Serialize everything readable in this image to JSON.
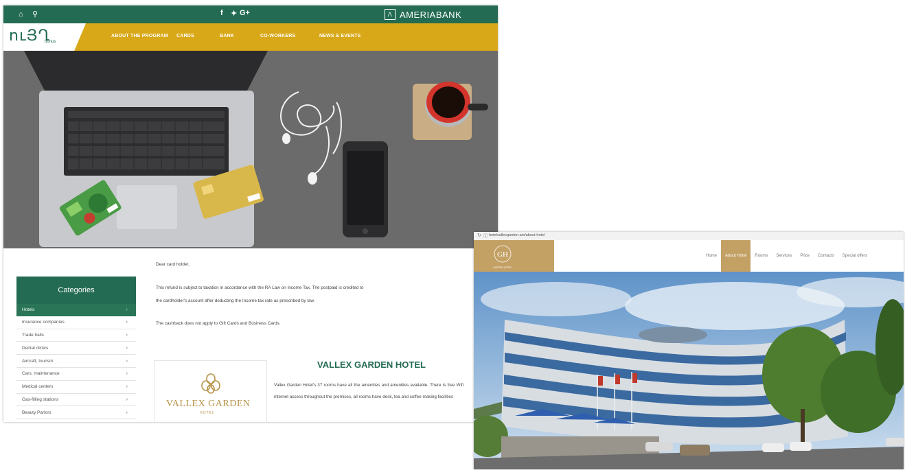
{
  "bank_site": {
    "topbar": {
      "home_icon": "home-icon",
      "search_icon": "search-icon",
      "social": [
        "f",
        "๏",
        "G+"
      ],
      "brand": "AMERIABANK"
    },
    "logo": {
      "text": "ուՅՂ",
      "sub": "bonus"
    },
    "nav": [
      "ABOUT THE PROGRAM",
      "CARDS",
      "BANK",
      "CO-WORKERS",
      "NEWS & EVENTS"
    ],
    "categories": {
      "title": "Categories",
      "items": [
        "Hotels",
        "Insurance companies",
        "Trade halls",
        "Dental clinics",
        "Aircraft, tourism",
        "Cars, maintenance",
        "Medical centers",
        "Gas-filling stations",
        "Beauty Parlors"
      ]
    },
    "content": {
      "greeting": "Dear card holder,",
      "refund_line1": "This refund is subject to taxation in accordance with the RA Law on Income Tax. The postpaid is credited to",
      "refund_line2": "the cardholder's account after deducting the Income tax rate as prescribed by law.",
      "cashback": "The cashback does not apply to Gift Cards and Business Cards."
    },
    "hotel": {
      "logo_name": "VALLEX GARDEN",
      "logo_sub": "HOTEL",
      "title": "VALLEX GARDEN HOTEL",
      "text": "Vallex Garden Hotel's 37 rooms have all the amenities and amenities available. There is free Wifi internet access throughout the premises, all rooms have desk, tea and coffee making facilities"
    }
  },
  "hotel_site": {
    "address": "hotelvallexgarden.am/about-hotel",
    "nav": [
      "Home",
      "About Hotel",
      "Rooms",
      "Services",
      "Price",
      "Contacts",
      "Special offers"
    ],
    "active_nav": "About Hotel",
    "logo_monogram": "GH",
    "logo_caption": "GARDEN HOTEL"
  },
  "colors": {
    "bank_green": "#236b52",
    "bank_gold": "#d8a818",
    "hotel_gold": "#c3a064"
  }
}
